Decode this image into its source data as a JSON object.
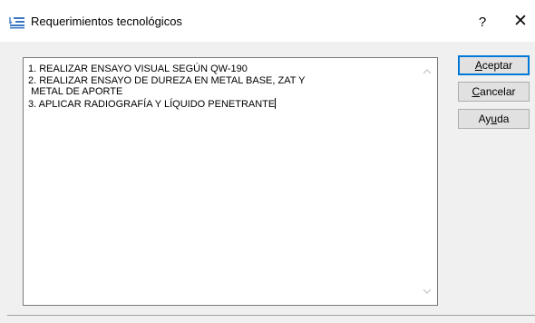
{
  "window": {
    "title": "Requerimientos tecnológicos",
    "help_glyph": "?",
    "close_glyph": "✕"
  },
  "editor": {
    "text": "1. REALIZAR ENSAYO VISUAL SEGÚN QW-190\n2. REALIZAR ENSAYO DE DUREZA EN METAL BASE, ZAT Y\n METAL DE APORTE\n3. APLICAR RADIOGRAFÍA Y LÍQUIDO PENETRANTE",
    "scroll_up_icon": "chevron-up-icon",
    "scroll_down_icon": "chevron-down-icon"
  },
  "buttons": {
    "accept": {
      "mnemonic": "A",
      "rest": "ceptar"
    },
    "cancel": {
      "mnemonic": "C",
      "rest": "ancelar"
    },
    "help": {
      "pre": "Ay",
      "mnemonic": "u",
      "post": "da"
    }
  },
  "colors": {
    "titlebar_bg": "#ffffff",
    "dialog_bg": "#f0f0f0",
    "default_button_border": "#0078d7",
    "button_bg": "#e1e1e1"
  }
}
